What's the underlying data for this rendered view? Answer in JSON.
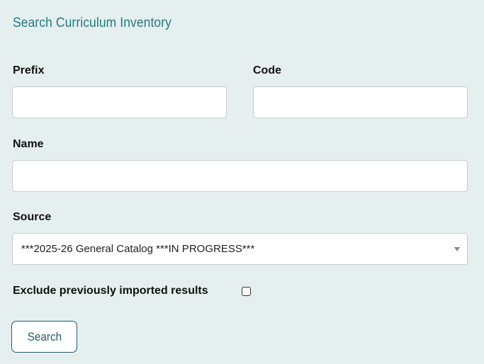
{
  "form": {
    "title": "Search Curriculum Inventory",
    "prefix_label": "Prefix",
    "prefix_value": "",
    "code_label": "Code",
    "code_value": "",
    "name_label": "Name",
    "name_value": "",
    "source_label": "Source",
    "source_value": "***2025-26 General Catalog ***IN PROGRESS***",
    "exclude_label": "Exclude previously imported results",
    "exclude_checked": false,
    "search_label": "Search"
  },
  "colors": {
    "background": "#e6eff0",
    "title": "#1e7d7d",
    "button_border": "#1e5f66"
  }
}
